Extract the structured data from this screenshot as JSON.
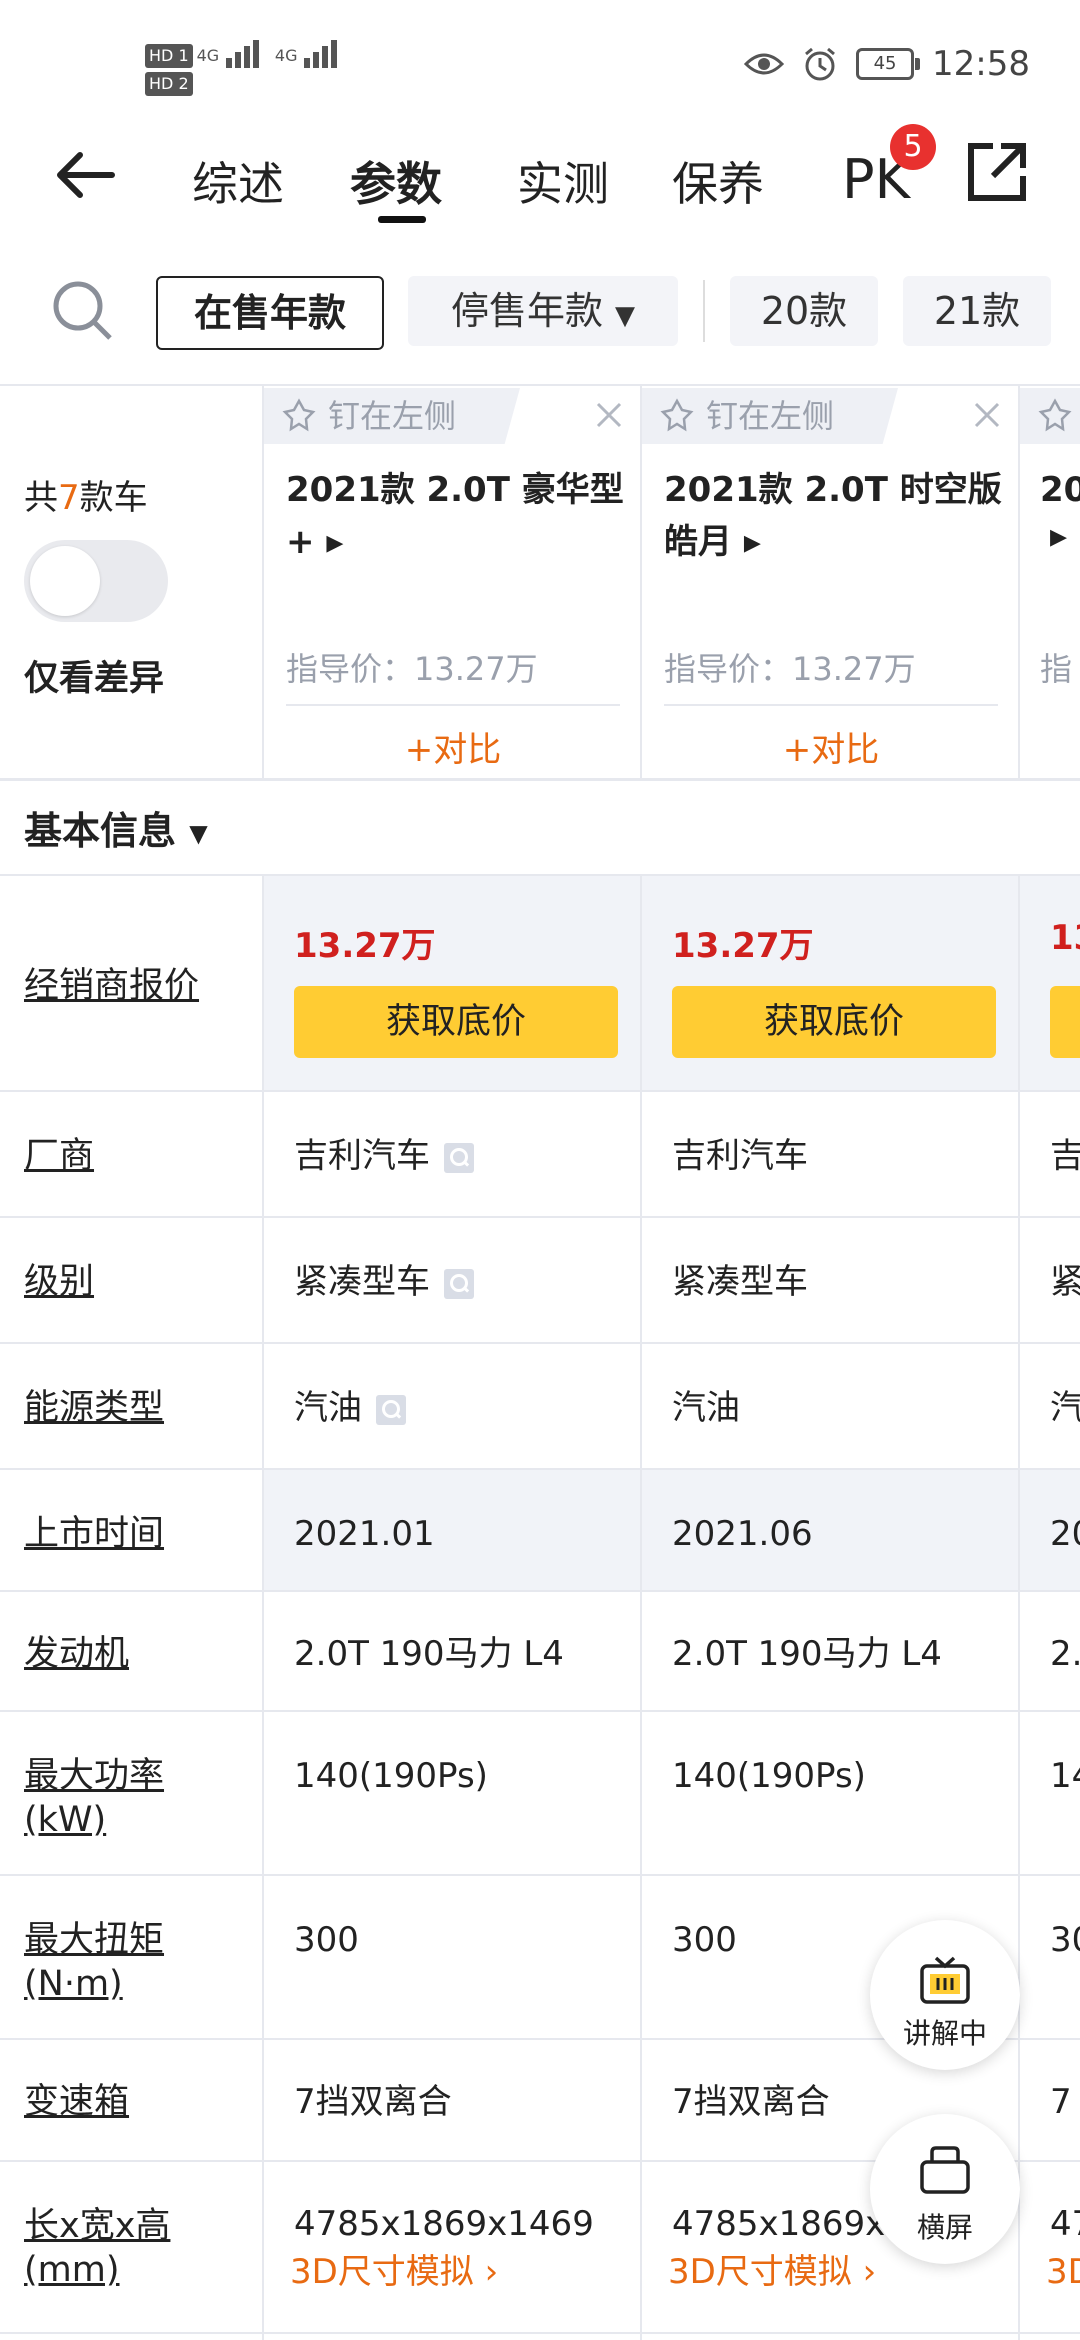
{
  "status_bar": {
    "hd1": "HD 1",
    "hd2": "HD 2",
    "net1": "4G",
    "net2": "4G",
    "battery": "45",
    "time": "12:58"
  },
  "nav": {
    "tabs": [
      "综述",
      "参数",
      "实测",
      "保养",
      "PK"
    ],
    "active_tab": "参数",
    "pk_badge": "5"
  },
  "filters": {
    "on_sale": "在售年款",
    "discontinued": "停售年款",
    "years": [
      "20款",
      "21款"
    ]
  },
  "summary": {
    "count_prefix": "共",
    "count": "7",
    "count_suffix": "款车",
    "diff_only": "仅看差异"
  },
  "cars": [
    {
      "pin": "钉在左侧",
      "name_line1": "2021款 2.0T 豪华型",
      "name_line2": "+ ▸",
      "guide_price": "指导价：13.27万",
      "compare": "+对比"
    },
    {
      "pin": "钉在左侧",
      "name_line1": "2021款 2.0T 时空版",
      "name_line2": "皓月 ▸",
      "guide_price": "指导价：13.27万",
      "compare": "+对比"
    },
    {
      "pin": "钉在左侧",
      "name_line1": "20",
      "name_line2": "▸",
      "guide_price": "指",
      "compare": ""
    }
  ],
  "section": {
    "title": "基本信息"
  },
  "dealer": {
    "label": "经销商报价",
    "prices": [
      "13.27万",
      "13.27万",
      "13"
    ],
    "button": "获取底价"
  },
  "rows": [
    {
      "label": "厂商",
      "values": [
        "吉利汽车",
        "吉利汽车",
        "吉"
      ]
    },
    {
      "label": "级别",
      "values": [
        "紧凑型车",
        "紧凑型车",
        "紧"
      ]
    },
    {
      "label": "能源类型",
      "values": [
        "汽油",
        "汽油",
        "汽"
      ]
    },
    {
      "label": "上市时间",
      "values": [
        "2021.01",
        "2021.06",
        "20"
      ]
    },
    {
      "label": "发动机",
      "values": [
        "2.0T 190马力 L4",
        "2.0T 190马力 L4",
        "2."
      ]
    },
    {
      "label_line1": "最大功率",
      "label_line2": "(kW)",
      "values": [
        "140(190Ps)",
        "140(190Ps)",
        "14"
      ]
    },
    {
      "label_line1": "最大扭矩",
      "label_line2": "(N·m)",
      "values": [
        "300",
        "300",
        "30"
      ]
    },
    {
      "label": "变速箱",
      "values": [
        "7挡双离合",
        "7挡双离合",
        "7"
      ]
    },
    {
      "label_line1": "长x宽x高",
      "label_line2": "(mm)",
      "values": [
        "4785x1869x1469",
        "4785x1869x",
        "47"
      ],
      "link": "3D尺寸模拟 ›",
      "link_short": "3D"
    }
  ],
  "floating": {
    "explain": "讲解中",
    "landscape": "横屏"
  }
}
